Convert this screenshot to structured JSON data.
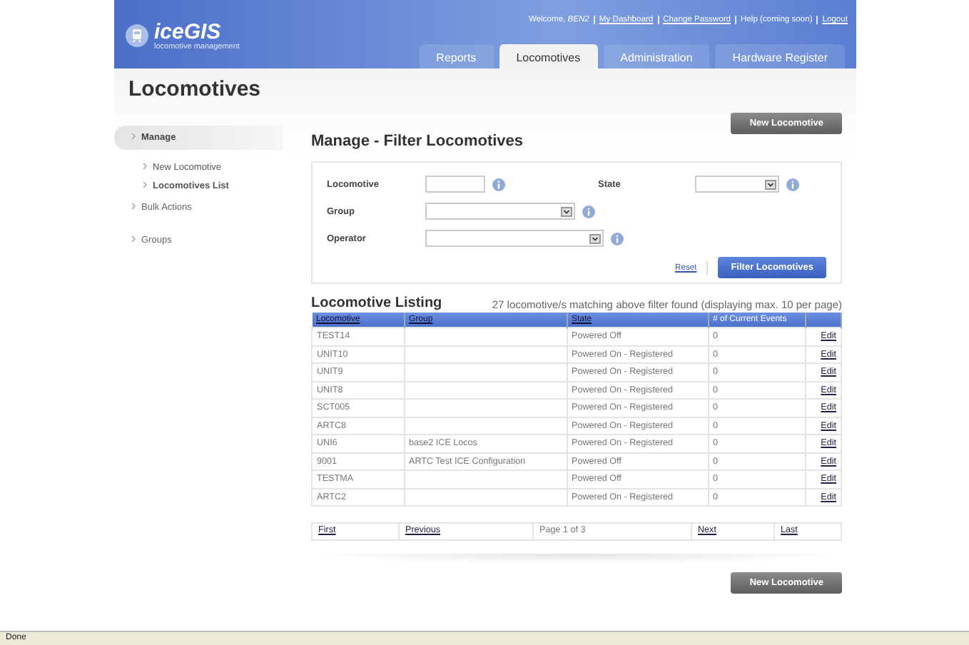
{
  "header": {
    "logo": {
      "title": "iceGIS",
      "subtitle": "locomotive management"
    },
    "welcome": "Welcome,",
    "user": "BEN2",
    "links": [
      {
        "label": "My Dashboard",
        "kind": "link"
      },
      {
        "label": "Change Password",
        "kind": "link"
      },
      {
        "label": "Help (coming soon)",
        "kind": "text"
      },
      {
        "label": "Logout",
        "kind": "link"
      }
    ],
    "tabs": [
      {
        "label": "Reports",
        "selected": false
      },
      {
        "label": "Locomotives",
        "selected": true
      },
      {
        "label": "Administration",
        "selected": false
      },
      {
        "label": "Hardware Register",
        "selected": false
      }
    ]
  },
  "page_title": "Locomotives",
  "new_button": "New Locomotive",
  "sidebar": {
    "items": [
      {
        "label": "Manage",
        "selected": true,
        "children": [
          {
            "label": "New Locomotive",
            "selected": false
          },
          {
            "label": "Locomotives List",
            "selected": true
          }
        ]
      },
      {
        "label": "Bulk Actions",
        "selected": false
      },
      {
        "label": "Groups",
        "selected": false
      }
    ]
  },
  "filter": {
    "title": "Manage - Filter Locomotives",
    "fields": [
      {
        "label": "Locomotive",
        "kind": "text"
      },
      {
        "label": "State",
        "kind": "select"
      },
      {
        "label": "Group",
        "kind": "select"
      },
      {
        "label": "Operator",
        "kind": "select"
      }
    ],
    "reset": "Reset",
    "submit": "Filter Locomotives"
  },
  "listing": {
    "title": "Locomotive Listing",
    "summary": "27 locomotive/s matching above filter found (displaying max. 10 per page)",
    "columns": [
      {
        "label": "Locomotive",
        "sortable": true
      },
      {
        "label": "Group",
        "sortable": true
      },
      {
        "label": "State",
        "sortable": true
      },
      {
        "label": "# of Current Events",
        "sortable": false
      }
    ],
    "rows": [
      {
        "cells": [
          "TEST14",
          "",
          "Powered Off",
          "0"
        ],
        "action": "Edit"
      },
      {
        "cells": [
          "UNIT10",
          "",
          "Powered On - Registered",
          "0"
        ],
        "action": "Edit"
      },
      {
        "cells": [
          "UNIT9",
          "",
          "Powered On - Registered",
          "0"
        ],
        "action": "Edit"
      },
      {
        "cells": [
          "UNIT8",
          "",
          "Powered On - Registered",
          "0"
        ],
        "action": "Edit"
      },
      {
        "cells": [
          "SCT005",
          "",
          "Powered On - Registered",
          "0"
        ],
        "action": "Edit"
      },
      {
        "cells": [
          "ARTC8",
          "",
          "Powered On - Registered",
          "0"
        ],
        "action": "Edit"
      },
      {
        "cells": [
          "UNI6",
          "base2 ICE Locos",
          "Powered On - Registered",
          "0"
        ],
        "action": "Edit"
      },
      {
        "cells": [
          "9001",
          "ARTC Test ICE Configuration",
          "Powered Off",
          "0"
        ],
        "action": "Edit"
      },
      {
        "cells": [
          "TESTMA",
          "",
          "Powered Off",
          "0"
        ],
        "action": "Edit"
      },
      {
        "cells": [
          "ARTC2",
          "",
          "Powered On - Registered",
          "0"
        ],
        "action": "Edit"
      }
    ],
    "pagination": {
      "first": "First",
      "previous": "Previous",
      "page": "Page 1 of 3",
      "next": "Next",
      "last": "Last"
    }
  },
  "bottom_button": "New Locomotive",
  "status_bar": "Done"
}
